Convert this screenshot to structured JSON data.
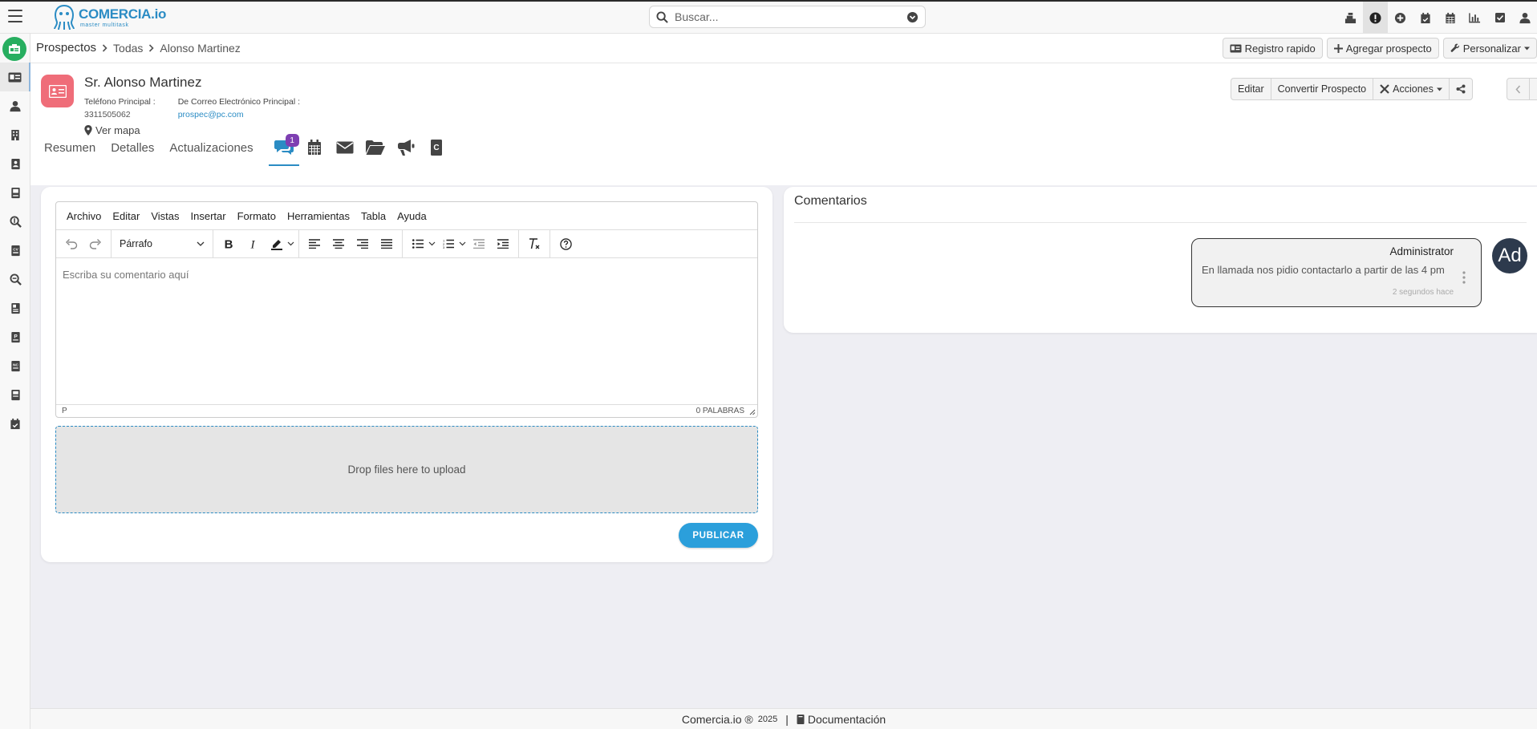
{
  "header": {
    "brand": "COMERCIA.io",
    "tagline": "master multitask",
    "search_placeholder": "Buscar...",
    "icons": [
      "cash-register-icon",
      "alert-icon",
      "plus-circle-icon",
      "calendar-check-icon",
      "calendar-icon",
      "bar-chart-icon",
      "checkbox-icon",
      "user-icon"
    ]
  },
  "sidebar": {
    "items": [
      "contact-card-icon",
      "person-icon",
      "building-icon",
      "address-book-icon",
      "ledger-icon",
      "search-dollar-icon",
      "cv-icon",
      "search-icon",
      "report-icon",
      "invoice-p-icon",
      "invoice-nc-icon",
      "receipt-icon",
      "calendar-check-icon"
    ]
  },
  "breadcrumb": {
    "module": "Prospectos",
    "list": "Todas",
    "record": "Alonso Martinez"
  },
  "crumb_actions": {
    "quick": "Registro rapido",
    "add": "Agregar prospecto",
    "customize": "Personalizar"
  },
  "record": {
    "title": "Sr. Alonso Martinez",
    "phone_label": "Teléfono Principal :",
    "phone": "3311505062",
    "email_label": "De Correo Electrónico Principal :",
    "email": "prospec@pc.com",
    "map": "Ver mapa",
    "actions": {
      "edit": "Editar",
      "convert": "Convertir Prospecto",
      "actions": "Acciones"
    }
  },
  "tabs": {
    "summary": "Resumen",
    "details": "Detalles",
    "updates": "Actualizaciones",
    "comments_badge": "1"
  },
  "editor": {
    "menu": [
      "Archivo",
      "Editar",
      "Vistas",
      "Insertar",
      "Formato",
      "Herramientas",
      "Tabla",
      "Ayuda"
    ],
    "block_format": "Párrafo",
    "placeholder": "Escriba su comentario aquí",
    "path": "P",
    "word_count": "0 PALABRAS",
    "dropzone": "Drop files here to upload",
    "publish": "PUBLICAR"
  },
  "comments": {
    "title": "Comentarios",
    "items": [
      {
        "author": "Administrator",
        "text": "En llamada nos pidio contactarlo a partir de las 4 pm",
        "time": "2 segundos hace",
        "avatar": "Ad"
      }
    ]
  },
  "footer": {
    "brand": "Comercia.io ®",
    "year": "2025",
    "docs": "Documentación"
  },
  "colors": {
    "accent": "#2b8cc4",
    "record_icon": "#ef6d79",
    "badge": "#7e3fb2",
    "publish": "#2b9fdb",
    "avatar": "#2d3a4d"
  }
}
